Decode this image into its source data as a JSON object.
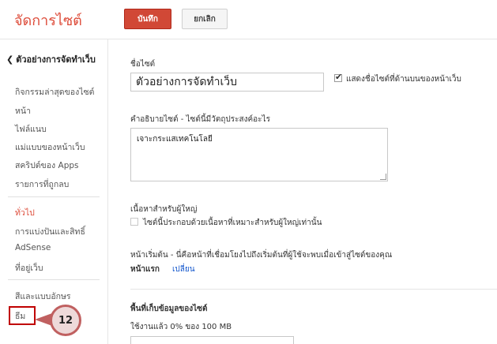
{
  "header": {
    "title": "จัดการไซต์",
    "save_label": "บันทึก",
    "cancel_label": "ยกเลิก"
  },
  "sidebar": {
    "back_label": "ตัวอย่างการจัดทำเว็บ",
    "groups": [
      [
        "กิจกรรมล่าสุดของไซต์",
        "หน้า",
        "ไฟล์แนบ",
        "แม่แบบของหน้าเว็บ",
        "สคริปต์ของ Apps",
        "รายการที่ถูกลบ"
      ],
      [
        "ทั่วไป",
        "การแบ่งปันและสิทธิ์",
        "AdSense",
        "ที่อยู่เว็บ"
      ],
      [
        "สีและแบบอักษร",
        "ธีม"
      ]
    ],
    "callout_number": "12"
  },
  "main": {
    "site_name_label": "ชื่อไซต์",
    "site_name_value": "ตัวอย่างการจัดทำเว็บ",
    "show_name_label": "แสดงชื่อไซต์ที่ด้านบนของหน้าเว็บ",
    "show_name_checked": true,
    "description_label": "คำอธิบายไซต์ - ไซต์นี้มีวัตถุประสงค์อะไร",
    "description_value": "เจาะกระแสเทคโนโลยี",
    "mature_label": "เนื้อหาสำหรับผู้ใหญ่",
    "mature_checkbox_label": "ไซต์นี้ประกอบด้วยเนื้อหาที่เหมาะสำหรับผู้ใหญ่เท่านั้น",
    "mature_checked": false,
    "landing_label": "หน้าเริ่มต้น - นี่คือหน้าที่เชื่อมโยงไปถึงเริ่มต้นที่ผู้ใช้จะพบเมื่อเข้าสู่ไซต์ของคุณ",
    "landing_value": "หน้าแรก",
    "landing_change_link": "เปลี่ยน",
    "storage_label": "พื้นที่เก็บข้อมูลของไซต์",
    "storage_usage": "ใช้งานแล้ว 0% ของ 100 MB"
  },
  "colors": {
    "accent": "#dd4b39",
    "save_button": "#d14836",
    "link": "#1155cc",
    "highlight": "#c00000"
  }
}
